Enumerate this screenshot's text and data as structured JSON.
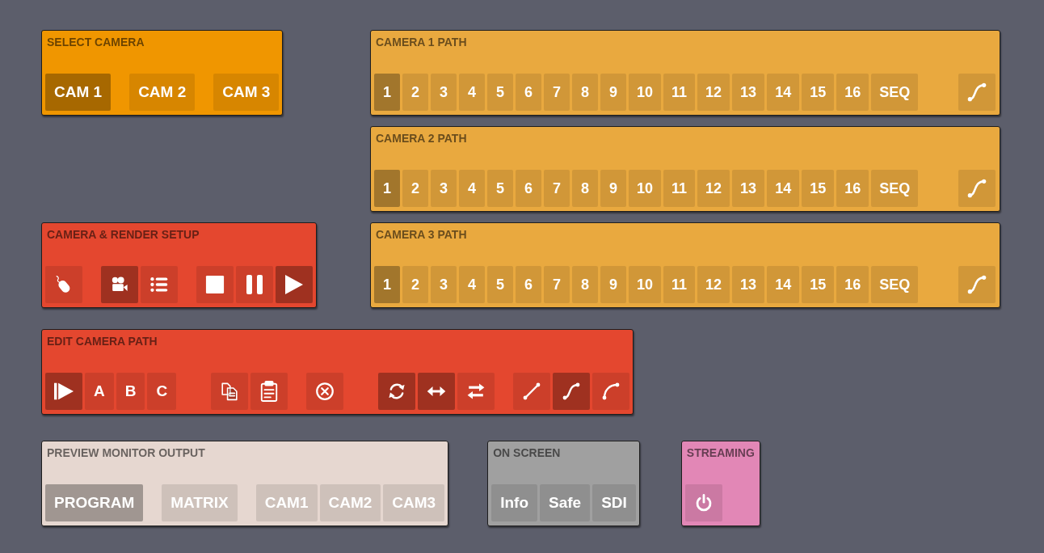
{
  "panels": [
    {
      "title": "SELECT CAMERA",
      "kind": "toolbar",
      "color": "#f09600",
      "groups": [
        {
          "buttons": [
            {
              "label": "CAM 1",
              "selected": true
            }
          ]
        },
        {
          "buttons": [
            {
              "label": "CAM 2",
              "selected": false
            }
          ]
        },
        {
          "buttons": [
            {
              "label": "CAM 3",
              "selected": false
            }
          ]
        }
      ]
    },
    {
      "title": "CAMERA 1 PATH",
      "kind": "path",
      "color": "#e9a93f",
      "groups": [
        {
          "buttons": [
            {
              "label": "1",
              "selected": true
            },
            {
              "label": "2",
              "selected": false
            },
            {
              "label": "3",
              "selected": false
            },
            {
              "label": "4",
              "selected": false
            },
            {
              "label": "5",
              "selected": false
            },
            {
              "label": "6",
              "selected": false
            },
            {
              "label": "7",
              "selected": false
            },
            {
              "label": "8",
              "selected": false
            },
            {
              "label": "9",
              "selected": false
            },
            {
              "label": "10",
              "selected": false
            },
            {
              "label": "11",
              "selected": false
            },
            {
              "label": "12",
              "selected": false
            },
            {
              "label": "13",
              "selected": false
            },
            {
              "label": "14",
              "selected": false
            },
            {
              "label": "15",
              "selected": false
            },
            {
              "label": "16",
              "selected": false
            },
            {
              "label": "SEQ",
              "selected": false
            }
          ]
        },
        {
          "buttons": [
            {
              "kind": "s-curve",
              "selected": false
            }
          ]
        }
      ]
    },
    {
      "title": "CAMERA 2 PATH",
      "kind": "path",
      "color": "#e9a93f",
      "groups": [
        {
          "buttons": [
            {
              "label": "1",
              "selected": true
            },
            {
              "label": "2",
              "selected": false
            },
            {
              "label": "3",
              "selected": false
            },
            {
              "label": "4",
              "selected": false
            },
            {
              "label": "5",
              "selected": false
            },
            {
              "label": "6",
              "selected": false
            },
            {
              "label": "7",
              "selected": false
            },
            {
              "label": "8",
              "selected": false
            },
            {
              "label": "9",
              "selected": false
            },
            {
              "label": "10",
              "selected": false
            },
            {
              "label": "11",
              "selected": false
            },
            {
              "label": "12",
              "selected": false
            },
            {
              "label": "13",
              "selected": false
            },
            {
              "label": "14",
              "selected": false
            },
            {
              "label": "15",
              "selected": false
            },
            {
              "label": "16",
              "selected": false
            },
            {
              "label": "SEQ",
              "selected": false
            }
          ]
        },
        {
          "buttons": [
            {
              "kind": "s-curve",
              "selected": false
            }
          ]
        }
      ]
    },
    {
      "title": "CAMERA & RENDER SETUP",
      "kind": "toolbar",
      "color": "#e4472f",
      "groups": [
        {
          "buttons": [
            {
              "kind": "mouse",
              "selected": false
            }
          ]
        },
        {
          "buttons": [
            {
              "kind": "movie-camera",
              "selected": true
            },
            {
              "kind": "list",
              "selected": false
            }
          ]
        },
        {
          "buttons": [
            {
              "kind": "stop",
              "selected": false
            },
            {
              "kind": "pause",
              "selected": false
            },
            {
              "kind": "play",
              "selected": true
            }
          ]
        }
      ]
    },
    {
      "title": "CAMERA 3 PATH",
      "kind": "path",
      "color": "#e9a93f",
      "groups": [
        {
          "buttons": [
            {
              "label": "1",
              "selected": true
            },
            {
              "label": "2",
              "selected": false
            },
            {
              "label": "3",
              "selected": false
            },
            {
              "label": "4",
              "selected": false
            },
            {
              "label": "5",
              "selected": false
            },
            {
              "label": "6",
              "selected": false
            },
            {
              "label": "7",
              "selected": false
            },
            {
              "label": "8",
              "selected": false
            },
            {
              "label": "9",
              "selected": false
            },
            {
              "label": "10",
              "selected": false
            },
            {
              "label": "11",
              "selected": false
            },
            {
              "label": "12",
              "selected": false
            },
            {
              "label": "13",
              "selected": false
            },
            {
              "label": "14",
              "selected": false
            },
            {
              "label": "15",
              "selected": false
            },
            {
              "label": "16",
              "selected": false
            },
            {
              "label": "SEQ",
              "selected": false
            }
          ]
        },
        {
          "buttons": [
            {
              "kind": "s-curve",
              "selected": false
            }
          ]
        }
      ]
    },
    {
      "title": "EDIT CAMERA PATH",
      "kind": "toolbar",
      "color": "#e4472f",
      "groups": [
        {
          "buttons": [
            {
              "kind": "step-play",
              "selected": true
            },
            {
              "label": "A",
              "selected": false
            },
            {
              "label": "B",
              "selected": false
            },
            {
              "label": "C",
              "selected": false
            }
          ]
        },
        {
          "buttons": [
            {
              "kind": "copy",
              "selected": false
            },
            {
              "kind": "clipboard",
              "selected": false
            }
          ]
        },
        {
          "buttons": [
            {
              "kind": "cancel",
              "selected": false
            }
          ]
        },
        {
          "buttons": [
            {
              "kind": "rotate",
              "selected": true
            },
            {
              "kind": "double-arrow",
              "selected": true
            },
            {
              "kind": "swap",
              "selected": false
            }
          ]
        },
        {
          "buttons": [
            {
              "kind": "line",
              "selected": false
            },
            {
              "kind": "s-curve",
              "selected": true
            },
            {
              "kind": "arc",
              "selected": false
            }
          ]
        }
      ]
    },
    {
      "title": "PREVIEW MONITOR OUTPUT",
      "kind": "toolbar",
      "color": "#e6d7d0",
      "groups": [
        {
          "buttons": [
            {
              "label": "PROGRAM",
              "selected": true
            }
          ]
        },
        {
          "buttons": [
            {
              "label": "MATRIX",
              "selected": false
            }
          ]
        },
        {
          "buttons": [
            {
              "label": "CAM1",
              "selected": false
            },
            {
              "label": "CAM2",
              "selected": false
            },
            {
              "label": "CAM3",
              "selected": false
            }
          ]
        }
      ]
    },
    {
      "title": "ON SCREEN",
      "kind": "toolbar",
      "color": "#a0a0a0",
      "groups": [
        {
          "buttons": [
            {
              "label": "Info",
              "selected": false
            },
            {
              "label": "Safe",
              "selected": false
            },
            {
              "label": "SDI",
              "selected": false
            }
          ]
        }
      ]
    },
    {
      "title": "STREAMING",
      "kind": "toolbar",
      "color": "#e287b6",
      "groups": [
        {
          "buttons": [
            {
              "kind": "power",
              "selected": false
            }
          ]
        }
      ]
    }
  ]
}
